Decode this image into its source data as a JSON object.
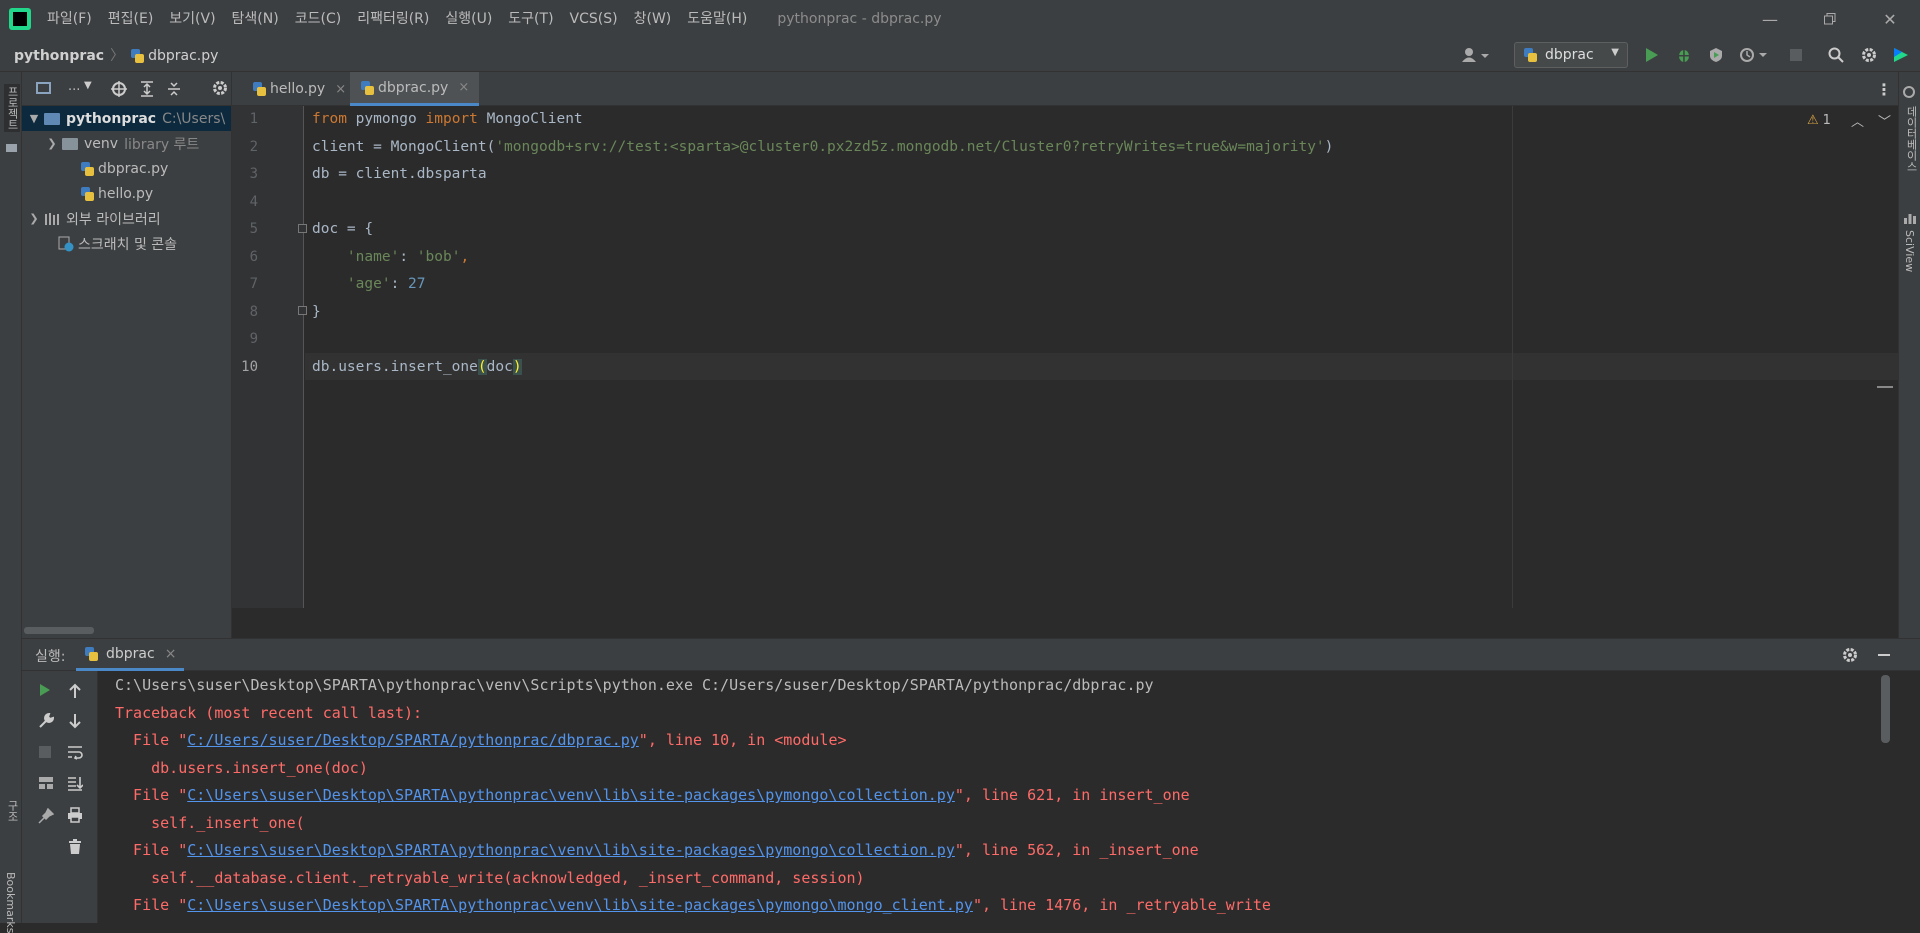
{
  "menu": [
    "파일(F)",
    "편집(E)",
    "보기(V)",
    "탐색(N)",
    "코드(C)",
    "리팩터링(R)",
    "실행(U)",
    "도구(T)",
    "VCS(S)",
    "창(W)",
    "도움말(H)"
  ],
  "window_title": "pythonprac - dbprac.py",
  "breadcrumb": {
    "project": "pythonprac",
    "file": "dbprac.py"
  },
  "run_config": "dbprac",
  "left_strip": {
    "project": "프로젝트",
    "structure": "구조",
    "bookmarks": "Bookmarks"
  },
  "right_strip": {
    "database": "데이터베이스",
    "sciview": "SciView"
  },
  "project_tree": {
    "tool_label": "...",
    "root": {
      "name": "pythonprac",
      "path": "C:\\Users\\"
    },
    "venv": {
      "name": "venv",
      "hint": "library 루트"
    },
    "files": [
      "dbprac.py",
      "hello.py"
    ],
    "external": "외부 라이브러리",
    "scratches": "스크래치 및 콘솔"
  },
  "tabs": [
    {
      "label": "hello.py",
      "close": "×"
    },
    {
      "label": "dbprac.py",
      "close": "×"
    }
  ],
  "editor": {
    "inspection": "1",
    "lines": {
      "n1": "1",
      "n2": "2",
      "n3": "3",
      "n4": "4",
      "n5": "5",
      "n6": "6",
      "n7": "7",
      "n8": "8",
      "n9": "9",
      "n10": "10",
      "l1_kw1": "from",
      "l1_mod": " pymongo ",
      "l1_kw2": "import",
      "l1_cls": " MongoClient",
      "l2_a": "client = MongoClient(",
      "l2_str": "'mongodb+srv://test:<sparta>@cluster0.px2zd5z.mongodb.net/Cluster0?retryWrites=true&w=majority'",
      "l2_b": ")",
      "l3": "db = client.dbsparta",
      "l5": "doc = {",
      "l6_key": "'name'",
      "l6_sep": ": ",
      "l6_val": "'bob'",
      "l6_end": ",",
      "l7_key": "'age'",
      "l7_sep": ": ",
      "l7_val": "27",
      "l8": "}",
      "l10_a": "db.users.insert_one",
      "l10_open": "(",
      "l10_arg": "doc",
      "l10_close": ")"
    }
  },
  "run": {
    "label": "실행:",
    "tab": "dbprac",
    "close": "×",
    "output": {
      "cmd": "C:\\Users\\suser\\Desktop\\SPARTA\\pythonprac\\venv\\Scripts\\python.exe C:/Users/suser/Desktop/SPARTA/pythonprac/dbprac.py",
      "tb": "Traceback (most recent call last):",
      "f1_pre": "  File \"",
      "f1_link": "C:/Users/suser/Desktop/SPARTA/pythonprac/dbprac.py",
      "f1_post": "\", line 10, in <module>",
      "c1": "    db.users.insert_one(doc)",
      "f2_pre": "  File \"",
      "f2_link": "C:\\Users\\suser\\Desktop\\SPARTA\\pythonprac\\venv\\lib\\site-packages\\pymongo\\collection.py",
      "f2_post": "\", line 621, in insert_one",
      "c2": "    self._insert_one(",
      "f3_pre": "  File \"",
      "f3_link": "C:\\Users\\suser\\Desktop\\SPARTA\\pythonprac\\venv\\lib\\site-packages\\pymongo\\collection.py",
      "f3_post": "\", line 562, in _insert_one",
      "c3": "    self.__database.client._retryable_write(acknowledged, _insert_command, session)",
      "f4_pre": "  File \"",
      "f4_link": "C:\\Users\\suser\\Desktop\\SPARTA\\pythonprac\\venv\\lib\\site-packages\\pymongo\\mongo_client.py",
      "f4_post": "\", line 1476, in _retryable_write"
    }
  },
  "colors": {
    "accent": "#4a88c7",
    "error": "#ff6b68",
    "link": "#5394ec",
    "run_green": "#499c54"
  }
}
